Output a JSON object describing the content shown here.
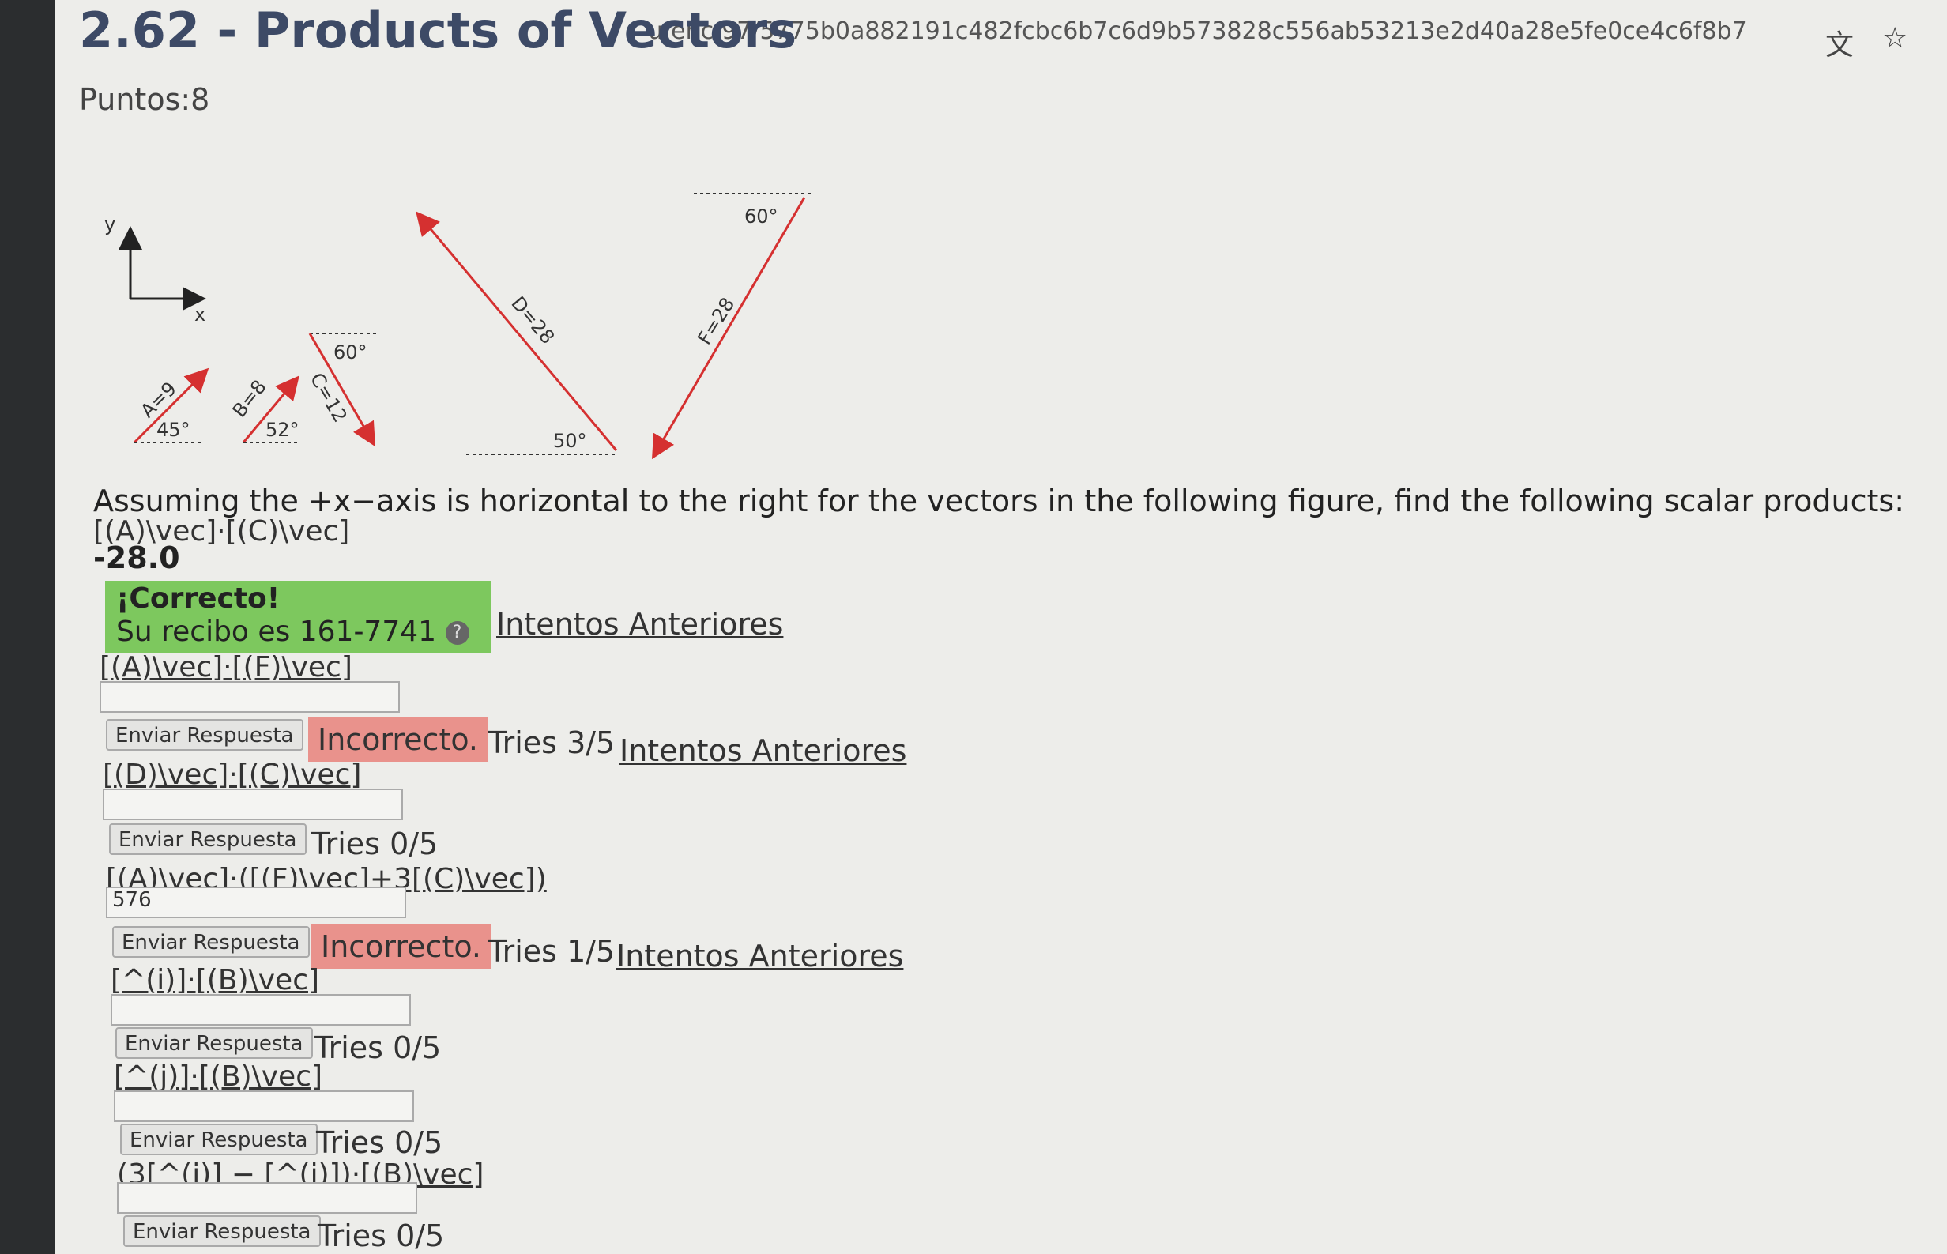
{
  "browser": {
    "url": "u/enc/97/5775b0a882191c482fcbc6b7c6d9b573828c556ab53213e2d40a28e5fe0ce4c6f8b7",
    "icons": [
      "translate-icon",
      "star-icon"
    ]
  },
  "header": {
    "title": "2.62 - Products of Vectors",
    "points": "Puntos:8"
  },
  "figure": {
    "axis_y": "y",
    "axis_x": "x",
    "A_label": "A=9",
    "A_angle": "45°",
    "B_label": "B=8",
    "B_angle": "52°",
    "C_label": "C=12",
    "C_angle": "60°",
    "D_label": "D=28",
    "D_angle": "50°",
    "F_label": "F=28",
    "F_angle": "60°"
  },
  "instruction": "Assuming the +x−axis is horizontal to the right for the vectors in the following figure, find the following scalar products:",
  "q0": {
    "expr": "[(A)\\vec]·[(C)\\vec]",
    "answer": "-28.0",
    "correct_title": "¡Correcto!",
    "receipt": "Su recibo es 161-7741",
    "prev": "Intentos Anteriores"
  },
  "q1": {
    "expr": "[(A)\\vec]·[(F)\\vec]",
    "value": "",
    "submit": "Enviar Respuesta",
    "status": "Incorrecto.",
    "tries": "Tries 3/5",
    "prev": "Intentos Anteriores"
  },
  "q2": {
    "expr": "[(D)\\vec]·[(C)\\vec]",
    "value": "",
    "submit": "Enviar Respuesta",
    "tries": "Tries 0/5"
  },
  "q3": {
    "expr": "[(A)\\vec]·([(F)\\vec]+3[(C)\\vec])",
    "value": "576",
    "submit": "Enviar Respuesta",
    "status": "Incorrecto.",
    "tries": "Tries 1/5",
    "prev": "Intentos Anteriores"
  },
  "q4": {
    "expr": "[^(i)]·[(B)\\vec]",
    "value": "",
    "submit": "Enviar Respuesta",
    "tries": "Tries 0/5"
  },
  "q5": {
    "expr": "[^(j)]·[(B)\\vec]",
    "value": "",
    "submit": "Enviar Respuesta",
    "tries": "Tries 0/5"
  },
  "q6": {
    "expr": "(3[^(i)] − [^(j)])·[(B)\\vec]",
    "value": "",
    "submit": "Enviar Respuesta",
    "tries": "Tries 0/5"
  }
}
